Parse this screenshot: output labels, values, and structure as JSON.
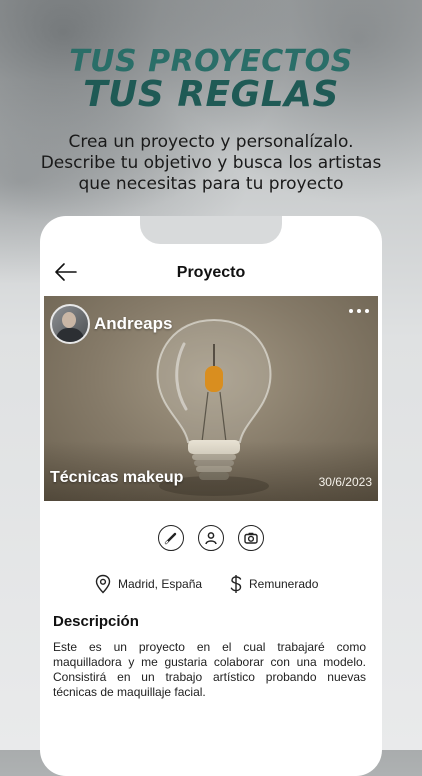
{
  "promo": {
    "headline_line1": "TUS PROYECTOS",
    "headline_line2": "TUS REGLAS",
    "subtitle_line1": "Crea un proyecto y personalízalo.",
    "subtitle_line2": "Describe tu objetivo y busca los artistas",
    "subtitle_line3": "que necesitas para tu proyecto"
  },
  "screen": {
    "title": "Proyecto"
  },
  "project": {
    "author": "Andreaps",
    "title": "Técnicas makeup",
    "date": "30/6/2023",
    "categories": [
      {
        "icon": "brush-icon"
      },
      {
        "icon": "person-icon"
      },
      {
        "icon": "camera-icon"
      }
    ],
    "location": "Madrid, España",
    "payment": "Remunerado",
    "description_heading": "Descripción",
    "description": "Este es un proyecto en el cual trabajaré como maquilladora y me gustaria colaborar con una modelo. Consistirá en un trabajo artístico probando nuevas técnicas de maquillaje facial."
  },
  "colors": {
    "headline": "#2a6e68",
    "background": "#e9eaeb",
    "card_surface": "#ffffff"
  }
}
